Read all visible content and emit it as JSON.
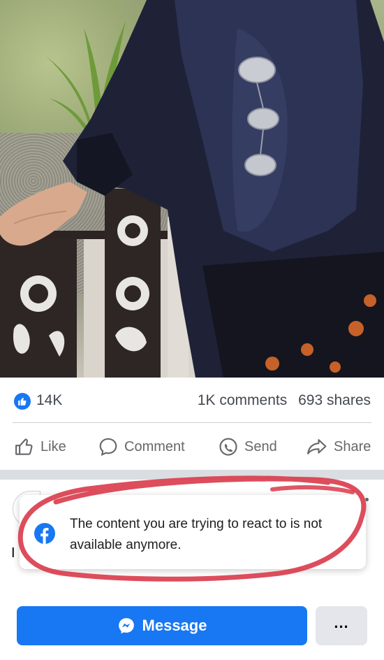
{
  "post": {
    "photo_alt": ""
  },
  "stats": {
    "like_count": "14K",
    "comments": "1K comments",
    "shares": "693 shares"
  },
  "actions": {
    "like": "Like",
    "comment": "Comment",
    "send": "Send",
    "share": "Share"
  },
  "lower": {
    "partial_letter": "I"
  },
  "toast": {
    "message": "The content you are trying to react to is not available anymore."
  },
  "footer": {
    "message_button": "Message",
    "more_button": "..."
  },
  "colors": {
    "brand_blue": "#1877f2",
    "annotation_red": "#d93a4a"
  },
  "icons": {
    "like_badge": "thumbs-up-icon",
    "like": "thumbs-up-outline-icon",
    "comment": "speech-bubble-icon",
    "send": "messenger-send-icon",
    "share": "share-arrow-icon",
    "toast": "facebook-logo-icon",
    "message": "messenger-icon"
  }
}
